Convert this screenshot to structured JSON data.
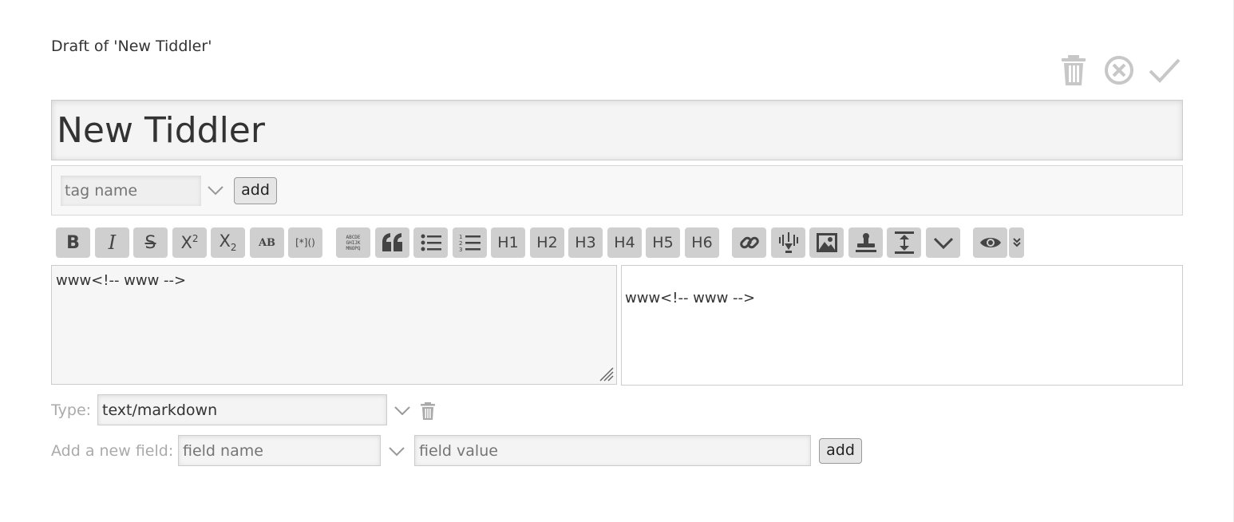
{
  "header": {
    "draft_title": "Draft of 'New Tiddler'",
    "controls": [
      {
        "name": "delete",
        "icon": "trash-icon"
      },
      {
        "name": "cancel",
        "icon": "cancel-circle-icon"
      },
      {
        "name": "done",
        "icon": "checkmark-icon"
      }
    ]
  },
  "title_field": {
    "value": "New Tiddler"
  },
  "tags": {
    "placeholder": "tag name",
    "add_label": "add"
  },
  "toolbar": {
    "buttons": [
      {
        "name": "bold",
        "label": "B",
        "icon": "bold-icon"
      },
      {
        "name": "italic",
        "label": "I",
        "icon": "italic-icon"
      },
      {
        "name": "strikethrough",
        "label": "S",
        "icon": "strikethrough-icon"
      },
      {
        "name": "superscript",
        "label": "X2",
        "icon": "superscript-icon"
      },
      {
        "name": "subscript",
        "label": "X2",
        "icon": "subscript-icon"
      },
      {
        "name": "smallcaps",
        "label": "AB",
        "icon": "smallcaps-icon"
      },
      {
        "name": "transcludify",
        "label": "[*]()",
        "icon": "transclude-icon"
      },
      {
        "name": "mono-block",
        "label": "ABCDE GHIJK MNOPQ",
        "icon": "monospace-block-icon"
      },
      {
        "name": "quote",
        "label": "",
        "icon": "quote-icon"
      },
      {
        "name": "list-bullet",
        "label": "",
        "icon": "list-bullet-icon"
      },
      {
        "name": "list-number",
        "label": "",
        "icon": "list-number-icon"
      },
      {
        "name": "heading-1",
        "label": "H1",
        "icon": "heading-1-icon"
      },
      {
        "name": "heading-2",
        "label": "H2",
        "icon": "heading-2-icon"
      },
      {
        "name": "heading-3",
        "label": "H3",
        "icon": "heading-3-icon"
      },
      {
        "name": "heading-4",
        "label": "H4",
        "icon": "heading-4-icon"
      },
      {
        "name": "heading-5",
        "label": "H5",
        "icon": "heading-5-icon"
      },
      {
        "name": "heading-6",
        "label": "H6",
        "icon": "heading-6-icon"
      },
      {
        "name": "link",
        "label": "",
        "icon": "link-icon"
      },
      {
        "name": "excise",
        "label": "",
        "icon": "excise-icon"
      },
      {
        "name": "picture",
        "label": "",
        "icon": "picture-icon"
      },
      {
        "name": "stamp",
        "label": "",
        "icon": "stamp-icon"
      },
      {
        "name": "editor-height",
        "label": "",
        "icon": "editor-height-icon"
      },
      {
        "name": "more",
        "label": "",
        "icon": "chevron-down-icon"
      },
      {
        "name": "preview",
        "label": "",
        "icon": "eye-icon"
      },
      {
        "name": "preview-type",
        "label": "",
        "icon": "double-chevron-down-icon"
      }
    ]
  },
  "editor": {
    "text": "www<!-- www -->"
  },
  "preview": {
    "text": "www<!-- www -->"
  },
  "type_row": {
    "label": "Type:",
    "value": "text/markdown"
  },
  "new_field": {
    "label": "Add a new field:",
    "name_placeholder": "field name",
    "value_placeholder": "field value",
    "add_label": "add"
  }
}
